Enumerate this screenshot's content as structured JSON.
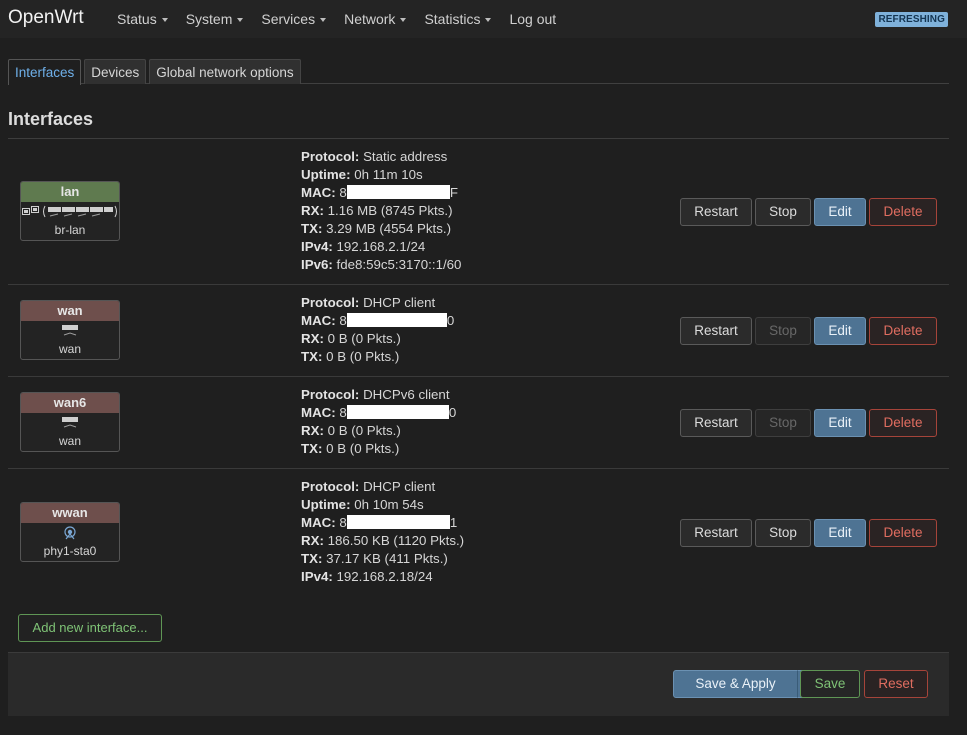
{
  "header": {
    "brand": "OpenWrt",
    "menu": [
      {
        "label": "Status",
        "dropdown": true
      },
      {
        "label": "System",
        "dropdown": true
      },
      {
        "label": "Services",
        "dropdown": true
      },
      {
        "label": "Network",
        "dropdown": true
      },
      {
        "label": "Statistics",
        "dropdown": true
      },
      {
        "label": "Log out",
        "dropdown": false
      }
    ],
    "status_badge": "REFRESHING"
  },
  "tabs": [
    {
      "label": "Interfaces",
      "active": true
    },
    {
      "label": "Devices",
      "active": false
    },
    {
      "label": "Global network options",
      "active": false
    }
  ],
  "section_title": "Interfaces",
  "interfaces": [
    {
      "name": "lan",
      "device": "br-lan",
      "badge_color": "#5f7a4f",
      "icons": [
        "bridge-icon",
        "ethernet-ports-icon"
      ],
      "fields": [
        {
          "label": "Protocol:",
          "value": "Static address"
        },
        {
          "label": "Uptime:",
          "value": "0h 11m 10s"
        },
        {
          "label": "MAC:",
          "value_prefix": "8",
          "value_suffix": "F",
          "redacted": true
        },
        {
          "label": "RX:",
          "value": "1.16 MB (8745 Pkts.)"
        },
        {
          "label": "TX:",
          "value": "3.29 MB (4554 Pkts.)"
        },
        {
          "label": "IPv4:",
          "value": "192.168.2.1/24"
        },
        {
          "label": "IPv6:",
          "value": "fde8:59c5:3170::1/60"
        }
      ],
      "buttons": {
        "restart": "Restart",
        "stop": "Stop",
        "stop_disabled": false,
        "edit": "Edit",
        "delete": "Delete"
      }
    },
    {
      "name": "wan",
      "device": "wan",
      "badge_color": "#6e4f4c",
      "icons": [
        "ethernet-port-icon"
      ],
      "fields": [
        {
          "label": "Protocol:",
          "value": "DHCP client"
        },
        {
          "label": "MAC:",
          "value_prefix": "8",
          "value_suffix": "0",
          "redacted": true
        },
        {
          "label": "RX:",
          "value": "0 B (0 Pkts.)"
        },
        {
          "label": "TX:",
          "value": "0 B (0 Pkts.)"
        }
      ],
      "buttons": {
        "restart": "Restart",
        "stop": "Stop",
        "stop_disabled": true,
        "edit": "Edit",
        "delete": "Delete"
      }
    },
    {
      "name": "wan6",
      "device": "wan",
      "badge_color": "#6e4f4c",
      "icons": [
        "ethernet-port-icon"
      ],
      "fields": [
        {
          "label": "Protocol:",
          "value": "DHCPv6 client"
        },
        {
          "label": "MAC:",
          "value_prefix": "8",
          "value_suffix": "0",
          "redacted": true
        },
        {
          "label": "RX:",
          "value": "0 B (0 Pkts.)"
        },
        {
          "label": "TX:",
          "value": "0 B (0 Pkts.)"
        }
      ],
      "buttons": {
        "restart": "Restart",
        "stop": "Stop",
        "stop_disabled": true,
        "edit": "Edit",
        "delete": "Delete"
      }
    },
    {
      "name": "wwan",
      "device": "phy1-sta0",
      "badge_color": "#6e4f4c",
      "icons": [
        "wifi-icon"
      ],
      "fields": [
        {
          "label": "Protocol:",
          "value": "DHCP client"
        },
        {
          "label": "Uptime:",
          "value": "0h 10m 54s"
        },
        {
          "label": "MAC:",
          "value_prefix": "8",
          "value_suffix": "1",
          "redacted": true
        },
        {
          "label": "RX:",
          "value": "186.50 KB (1120 Pkts.)"
        },
        {
          "label": "TX:",
          "value": "37.17 KB (411 Pkts.)"
        },
        {
          "label": "IPv4:",
          "value": "192.168.2.18/24"
        }
      ],
      "buttons": {
        "restart": "Restart",
        "stop": "Stop",
        "stop_disabled": false,
        "edit": "Edit",
        "delete": "Delete"
      }
    }
  ],
  "add_interface_label": "Add new interface...",
  "footer": {
    "save_apply": "Save & Apply",
    "save": "Save",
    "reset": "Reset"
  },
  "colors": {
    "accent_blue": "#4e7393",
    "tab_active": "#6fb0ea",
    "positive_green": "#7fc376",
    "danger_red": "#e06d60",
    "badge_blue": "#7fb1da"
  }
}
